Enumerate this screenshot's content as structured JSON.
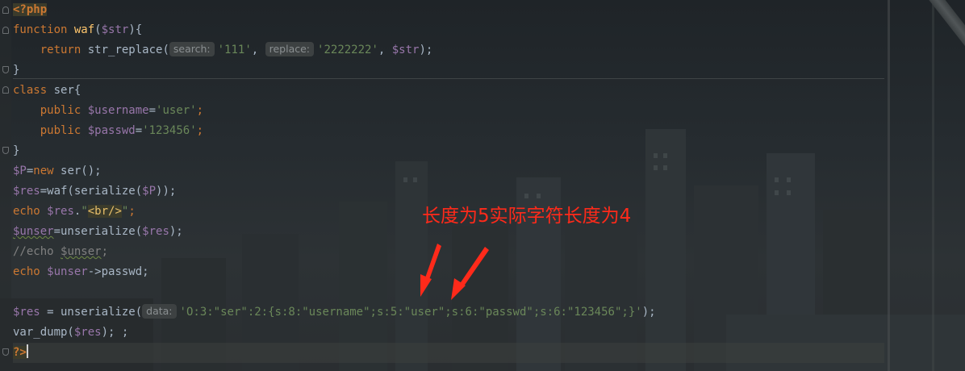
{
  "editor": {
    "lines": {
      "l1_open": "<?php",
      "l2_kw": "function",
      "l2_fn": "waf",
      "l2_p1": "(",
      "l2_var": "$str",
      "l2_p2": "){",
      "l3_kw": "return",
      "l3_fn": " str_replace(",
      "l3_hint1": "search:",
      "l3_s1": "'111'",
      "l3_c1": ", ",
      "l3_hint2": "replace:",
      "l3_s2": "'2222222'",
      "l3_c2": ", ",
      "l3_var": "$str",
      "l3_end": ");",
      "l4": "}",
      "l5_kw": "class",
      "l5_rest": " ser{",
      "l6_kw": "public",
      "l6_var": "$username",
      "l6_eq": "=",
      "l6_str": "'user'",
      "l6_end": ";",
      "l7_kw": "public",
      "l7_var": "$passwd",
      "l7_eq": "=",
      "l7_str": "'123456'",
      "l7_end": ";",
      "l8": "}",
      "l9_var": "$P",
      "l9_eq": "=",
      "l9_kw": "new",
      "l9_rest": " ser();",
      "l10_var": "$res",
      "l10_rest1": "=waf(serialize(",
      "l10_var2": "$P",
      "l10_rest2": "));",
      "l11_kw": "echo",
      "l11_var": "$res",
      "l11_dot": ".",
      "l11_q1": "\"",
      "l11_tag": "<br/>",
      "l11_q2": "\"",
      "l11_end": ";",
      "l12_var": "$unser",
      "l12_rest": "=unserialize(",
      "l12_var2": "$res",
      "l12_end": ");",
      "l13_cmt": "//echo ",
      "l13_var": "$unser",
      "l13_end": ";",
      "l14_kw": "echo",
      "l14_var": "$unser",
      "l14_rest": "->passwd;",
      "l16_var": "$res",
      "l16_rest": " = unserialize(",
      "l16_hint": "data:",
      "l16_str": "'O:3:\"ser\":2:{s:8:\"username\";s:5:\"user\";s:6:\"passwd\";s:6:\"123456\";}'",
      "l16_end": ");",
      "l17_fn": "var_dump(",
      "l17_var": "$res",
      "l17_end": "); ;",
      "l18_close": "?>"
    }
  },
  "annotation": {
    "text": "长度为5实际字符长度为4",
    "color": "#ff2a1a"
  },
  "colors": {
    "keyword": "#cc7832",
    "function": "#ffc66d",
    "variable": "#9876aa",
    "string": "#6a8759",
    "comment": "#808080",
    "default": "#a9b7c6"
  }
}
